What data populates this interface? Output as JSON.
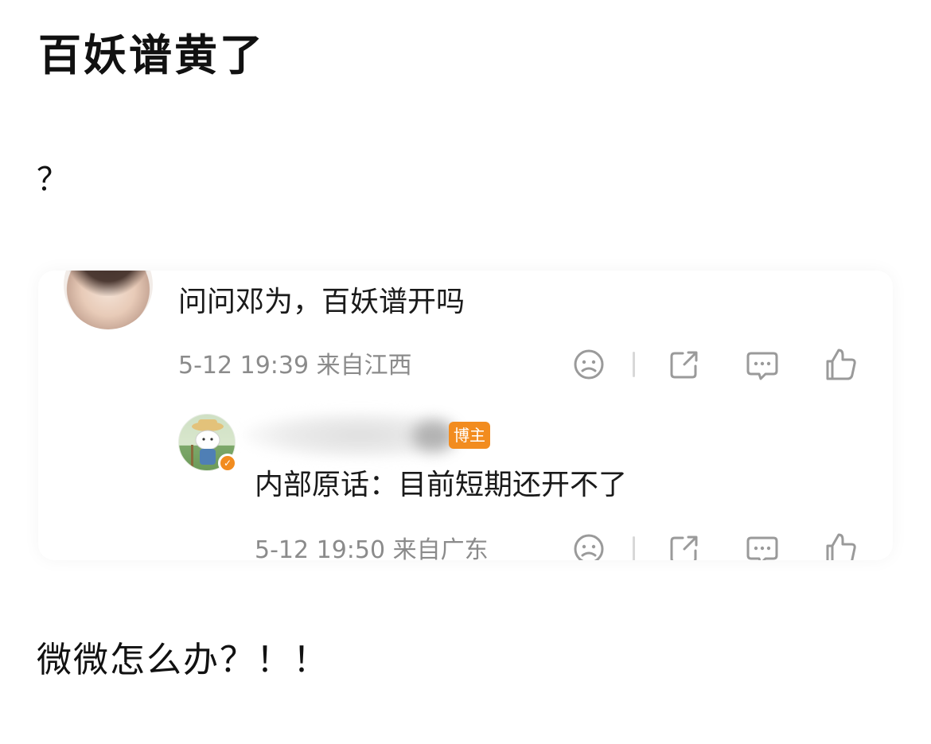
{
  "post": {
    "title": "百妖谱黄了",
    "body": "？",
    "footer": "微微怎么办？！！"
  },
  "comment": {
    "text": "问问邓为，百妖谱开吗",
    "meta": "5-12 19:39 来自江西",
    "avatar": "avatar-woman"
  },
  "reply": {
    "badge": "博主",
    "text": "内部原话：目前短期还开不了",
    "meta": "5-12 19:50 来自广东",
    "avatar": "avatar-cartoon-dog",
    "verified_icon": "verified-badge-icon"
  },
  "icons": {
    "emoji": "frown-emoji-icon",
    "share": "share-icon",
    "comment": "comment-bubble-icon",
    "like": "thumbs-up-icon"
  },
  "colors": {
    "badge": "#f28c1f",
    "meta": "#8b8b8b",
    "icon": "#9a9a9a"
  }
}
